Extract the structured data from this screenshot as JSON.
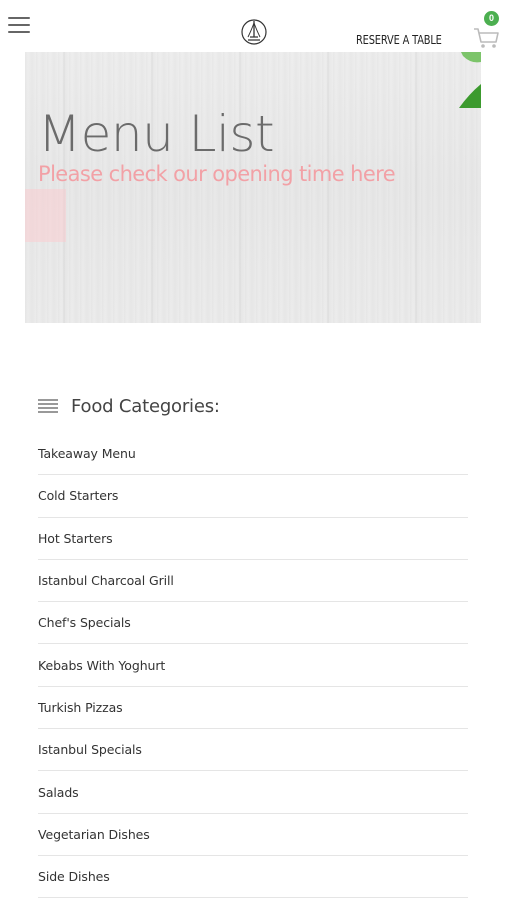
{
  "header": {
    "reserve_label": "RESERVE A TABLE",
    "cart_count": "0",
    "accent_color": "#4caf50"
  },
  "hero": {
    "title": "Menu List",
    "subtitle": "Please check our opening time here",
    "subtitle_color": "#f2a1a6"
  },
  "categories": {
    "heading": "Food Categories:",
    "items": [
      {
        "label": "Takeaway Menu"
      },
      {
        "label": "Cold Starters"
      },
      {
        "label": "Hot Starters"
      },
      {
        "label": "Istanbul Charcoal Grill"
      },
      {
        "label": "Chef's Specials"
      },
      {
        "label": "Kebabs With Yoghurt"
      },
      {
        "label": "Turkish Pizzas"
      },
      {
        "label": "Istanbul Specials"
      },
      {
        "label": "Salads"
      },
      {
        "label": "Vegetarian Dishes"
      },
      {
        "label": "Side Dishes"
      }
    ]
  },
  "icons": [
    "hamburger-menu-icon",
    "restaurant-logo",
    "shopping-cart-icon",
    "list-icon"
  ]
}
